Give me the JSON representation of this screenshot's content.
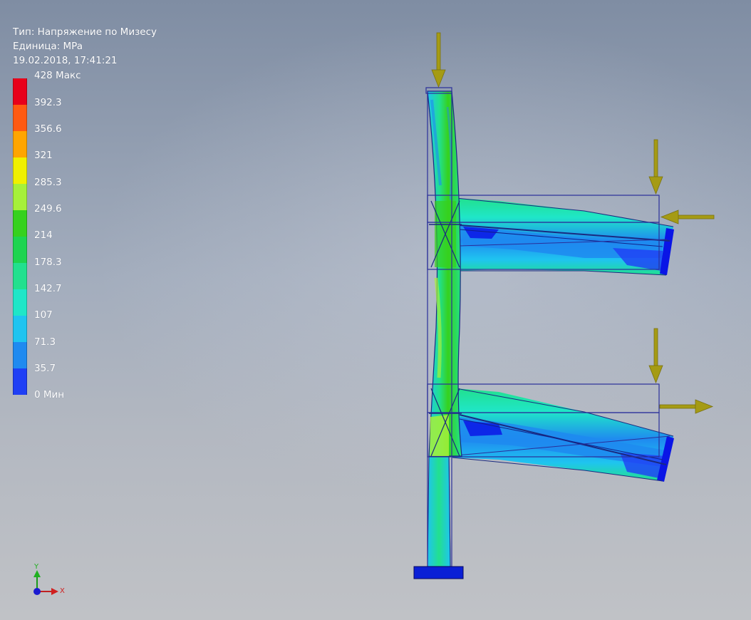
{
  "info": {
    "type_line": "Тип: Напряжение по Мизесу",
    "unit_line": "Единица: MPa",
    "timestamp": "19.02.2018, 17:41:21"
  },
  "legend": {
    "labels": [
      "428 Макс",
      "392.3",
      "356.6",
      "321",
      "285.3",
      "249.6",
      "214",
      "178.3",
      "142.7",
      "107",
      "71.3",
      "35.7",
      "0 Мин"
    ],
    "colors": [
      "#e8001a",
      "#ff5a12",
      "#ffa500",
      "#f0f000",
      "#a6f03a",
      "#36d11e",
      "#1ed450",
      "#22e08e",
      "#1fe6c8",
      "#1fc4f0",
      "#1f8af0",
      "#1f3ff5",
      "#0a15e6"
    ]
  },
  "triad": {
    "x_label": "X",
    "y_label": "Y"
  },
  "colors": {
    "arrow": "#a59b14",
    "wire": "#2a2f9a",
    "base": "#0a1fd6"
  }
}
